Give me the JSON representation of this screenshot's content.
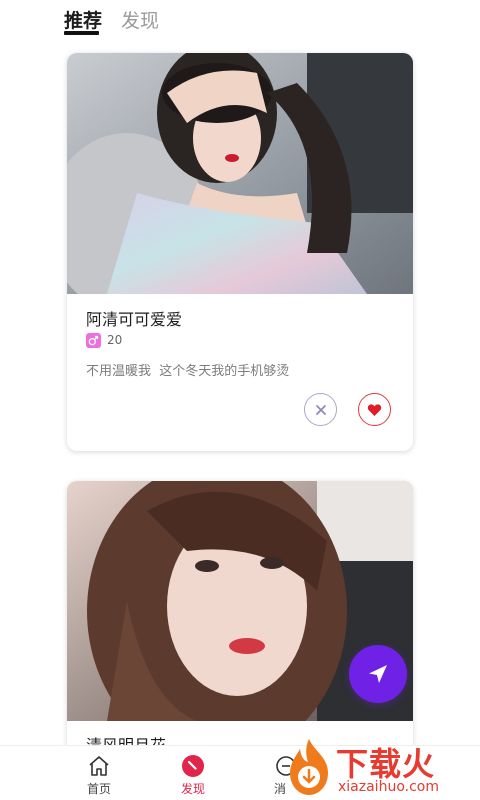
{
  "tabs": {
    "active": "推荐",
    "inactive": "发现"
  },
  "cards": [
    {
      "name": "阿清可可爱爱",
      "age": "20",
      "bio": "不用温暖我  这个冬天我的手机够烫"
    },
    {
      "name": "清风明月花"
    }
  ],
  "bottom_nav": {
    "home": "首页",
    "discover": "发现",
    "third": "消"
  },
  "watermark": {
    "brand": "下载火",
    "url": "xiazaihuo.com"
  },
  "icons": {
    "gender": "male-symbol-icon",
    "dismiss": "close-icon",
    "like": "heart-icon",
    "fab": "send-icon",
    "home": "home-icon",
    "discover": "compass-icon",
    "third": "chat-icon"
  },
  "colors": {
    "accent_red": "#e0244a",
    "fab_purple": "#6f22e6",
    "gender_pink": "#ec6fe0",
    "watermark_red": "#e83a2e"
  }
}
